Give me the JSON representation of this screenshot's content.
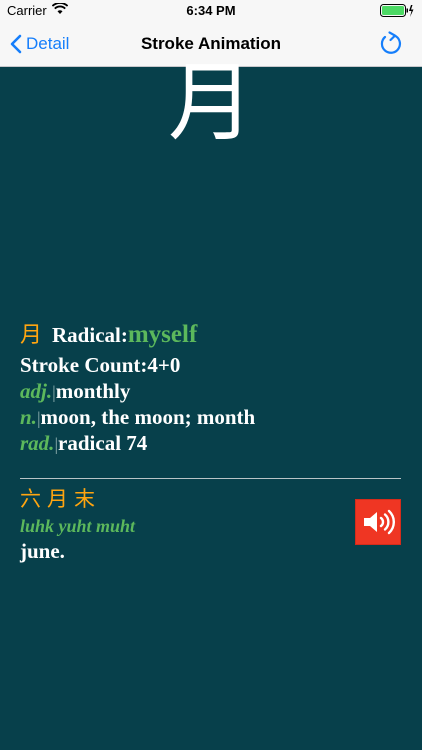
{
  "status": {
    "carrier": "Carrier",
    "time": "6:34 PM"
  },
  "nav": {
    "back_label": "Detail",
    "title": "Stroke Animation"
  },
  "character": "月",
  "radical": {
    "char": "月",
    "label": "Radical:",
    "value": "myself"
  },
  "stroke_count": "Stroke Count:4+0",
  "definitions": [
    {
      "pos": "adj.",
      "sep": "|",
      "text": "monthly"
    },
    {
      "pos": "n.",
      "sep": "|",
      "text": "moon, the moon; month"
    },
    {
      "pos": "rad.",
      "sep": "|",
      "text": "radical 74"
    }
  ],
  "example": {
    "chars": "六月末",
    "romanization": "luhk yuht muht",
    "meaning": "june."
  },
  "colors": {
    "accent": "#157efb",
    "background": "#07404b",
    "radical": "#ffa510",
    "green": "#5cb85c",
    "speaker": "#ef3623"
  },
  "icons": {
    "back": "chevron-left-icon",
    "refresh": "refresh-icon",
    "speaker": "speaker-icon",
    "wifi": "wifi-icon",
    "battery": "battery-icon"
  }
}
